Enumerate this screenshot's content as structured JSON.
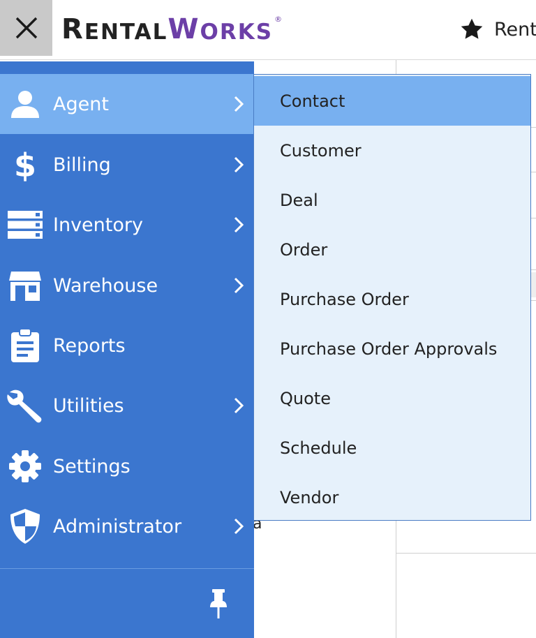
{
  "app": {
    "logo_part1_initial": "R",
    "logo_part1_rest": "ENTAL",
    "logo_part2_initial": "W",
    "logo_part2_rest": "ORKS",
    "logo_reg": "®",
    "favorites_label": "Rent"
  },
  "background": {
    "partial_text": "a"
  },
  "sidebar": {
    "items": [
      {
        "label": "Agent",
        "icon": "user-icon",
        "has_submenu": true,
        "active": true
      },
      {
        "label": "Billing",
        "icon": "dollar-icon",
        "has_submenu": true
      },
      {
        "label": "Inventory",
        "icon": "server-icon",
        "has_submenu": true
      },
      {
        "label": "Warehouse",
        "icon": "store-icon",
        "has_submenu": true
      },
      {
        "label": "Reports",
        "icon": "clipboard-icon",
        "has_submenu": false
      },
      {
        "label": "Utilities",
        "icon": "wrench-icon",
        "has_submenu": true
      },
      {
        "label": "Settings",
        "icon": "gear-icon",
        "has_submenu": false
      },
      {
        "label": "Administrator",
        "icon": "shield-icon",
        "has_submenu": true
      }
    ],
    "pin_icon": "pin-icon"
  },
  "submenu": {
    "items": [
      {
        "label": "Contact",
        "active": true
      },
      {
        "label": "Customer"
      },
      {
        "label": "Deal"
      },
      {
        "label": "Order"
      },
      {
        "label": "Purchase Order"
      },
      {
        "label": "Purchase Order Approvals"
      },
      {
        "label": "Quote"
      },
      {
        "label": "Schedule"
      },
      {
        "label": "Vendor"
      }
    ]
  },
  "colors": {
    "sidebar_bg": "#3b76cf",
    "active_item_bg": "#78b0f0",
    "submenu_bg": "#e6f1fb",
    "logo_purple": "#6c3fa7",
    "logo_dark": "#222222"
  }
}
